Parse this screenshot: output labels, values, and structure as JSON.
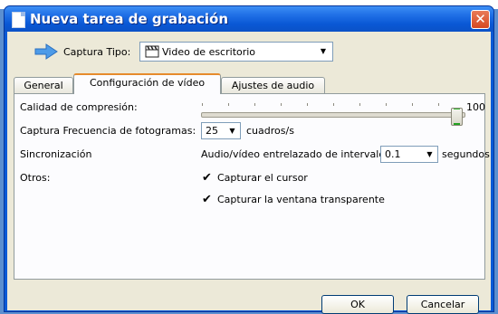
{
  "window": {
    "title": "Nueva tarea de grabación",
    "close_glyph": "✕"
  },
  "capture_type": {
    "label": "Captura Tipo:",
    "value": "Video de escritorio",
    "icon": "clapperboard-icon",
    "arrow_icon": "right-arrow-icon"
  },
  "tabs": [
    {
      "label": "General",
      "active": false
    },
    {
      "label": "Configuración de vídeo",
      "active": true
    },
    {
      "label": "Ajustes de audio",
      "active": false
    }
  ],
  "video_settings": {
    "compression": {
      "label": "Calidad de compresión:",
      "value": "100",
      "fraction": 1.0
    },
    "frame_rate": {
      "label": "Captura Frecuencia de fotogramas:",
      "value": "25",
      "unit": "cuadros/s"
    },
    "sync": {
      "label": "Sincronización",
      "interleave_label": "Audio/vídeo entrelazado de intervalo",
      "value": "0.1",
      "unit": "segundos"
    },
    "others": {
      "label": "Otros:",
      "capture_cursor": {
        "label": "Capturar el cursor",
        "checked": true
      },
      "capture_transparent": {
        "label": "Capturar la ventana transparente",
        "checked": true
      }
    }
  },
  "buttons": {
    "ok": "OK",
    "cancel": "Cancelar"
  },
  "colors": {
    "accent_tab": "#e68b2c",
    "titlebar": "#0a58d5",
    "close": "#d64822"
  }
}
